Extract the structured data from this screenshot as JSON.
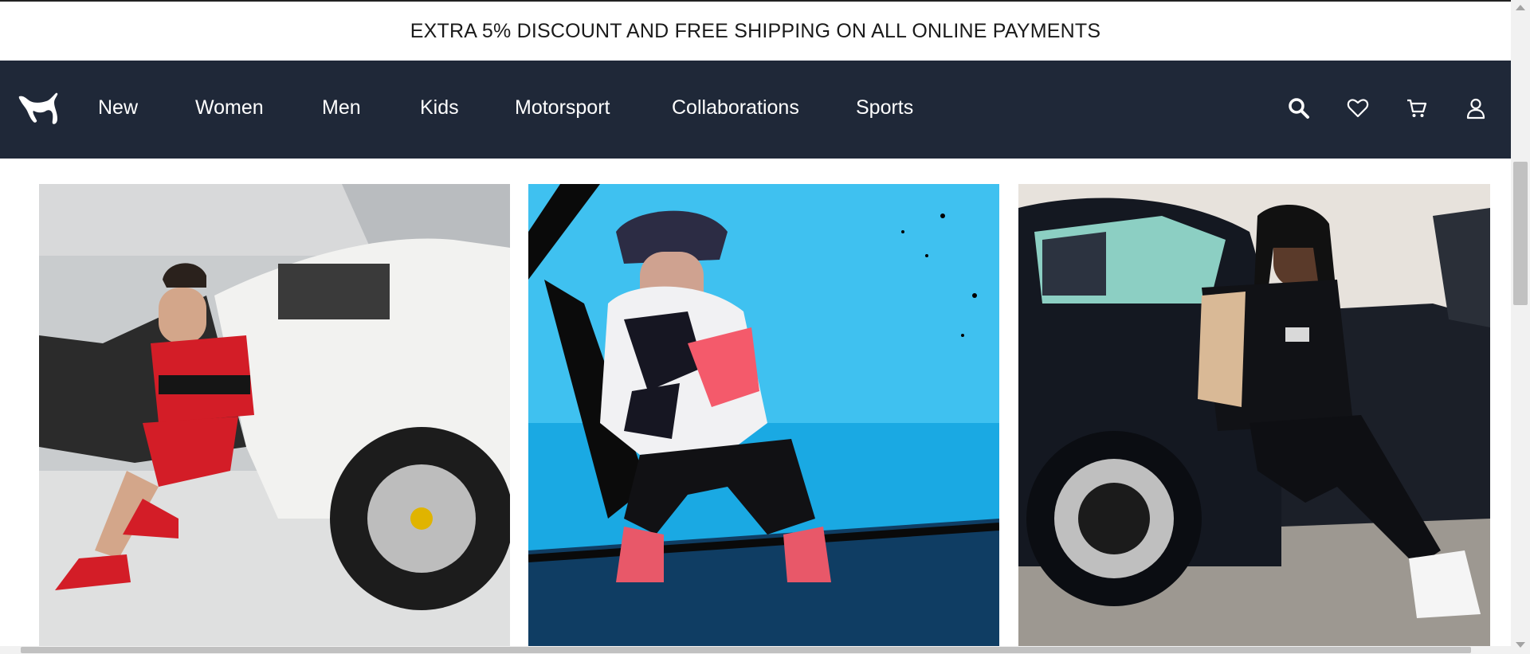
{
  "promo": {
    "text": "EXTRA 5% DISCOUNT AND FREE SHIPPING ON ALL ONLINE PAYMENTS"
  },
  "nav": {
    "logo": "puma-cat-logo",
    "links": [
      "New",
      "Women",
      "Men",
      "Kids",
      "Motorsport",
      "Collaborations",
      "Sports"
    ],
    "icons": [
      "search-icon",
      "heart-icon",
      "cart-icon",
      "user-icon"
    ]
  },
  "gallery": {
    "tiles": [
      {
        "subject": "model-in-red-tshirt-beside-white-sports-car"
      },
      {
        "subject": "model-in-graffiti-hoodie-on-blue-background"
      },
      {
        "subject": "model-in-black-hoodie-beside-black-car"
      }
    ]
  },
  "colors": {
    "nav_background": "#1f2838",
    "nav_text": "#ffffff",
    "promo_text": "#1a1a1a"
  }
}
